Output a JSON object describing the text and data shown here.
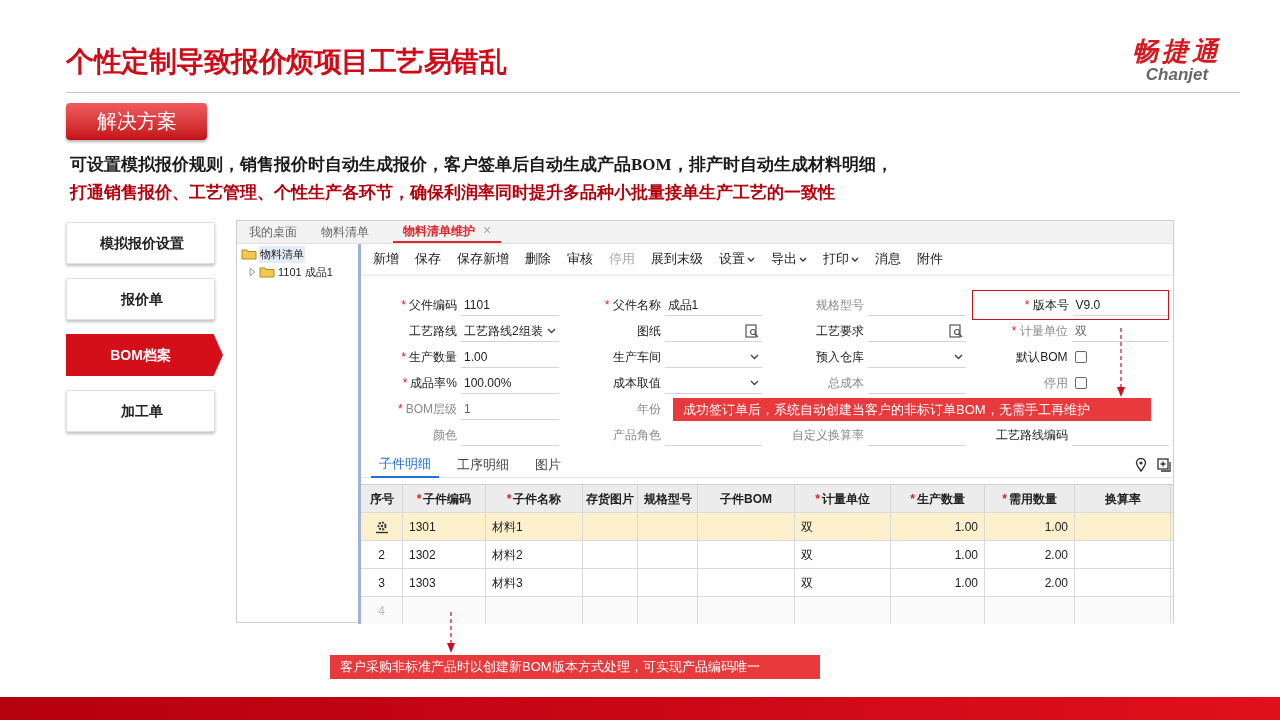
{
  "slide": {
    "title": "个性定制导致报价烦项目工艺易错乱",
    "logo": {
      "mark": "畅捷通",
      "latin": "Chanjet"
    },
    "section_tag": "解决方案",
    "description": [
      {
        "text": "可设置模拟报价规则，销售报价时自动生成报价，客户签单后自动生成产品BOM，排产时自动生成材料明细，",
        "highlight": false
      },
      {
        "text": "打通销售报价、工艺管理、个性生产各环节，确保利润率同时提升多品种小批量接单生产工艺的一致性",
        "highlight": true
      }
    ]
  },
  "nav": [
    {
      "label": "模拟报价设置",
      "selected": false
    },
    {
      "label": "报价单",
      "selected": false
    },
    {
      "label": "BOM档案",
      "selected": true
    },
    {
      "label": "加工单",
      "selected": false
    }
  ],
  "app": {
    "tabs": [
      {
        "label": "我的桌面",
        "selected": false
      },
      {
        "label": "物料清单",
        "selected": false
      },
      {
        "label": "物料清单维护",
        "selected": true,
        "close": "×"
      }
    ],
    "tree": {
      "label": "物料清单",
      "children": [
        {
          "label": "1101 成品1",
          "expanded": false
        }
      ]
    },
    "toolbar": [
      {
        "label": "新增",
        "disabled": false,
        "menu": false
      },
      {
        "label": "保存",
        "disabled": false,
        "menu": false
      },
      {
        "label": "保存新增",
        "disabled": false,
        "menu": false
      },
      {
        "label": "删除",
        "disabled": false,
        "menu": false
      },
      {
        "label": "审核",
        "disabled": false,
        "menu": false
      },
      {
        "label": "停用",
        "disabled": true,
        "menu": false
      },
      {
        "label": "展到末级",
        "disabled": false,
        "menu": false
      },
      {
        "label": "设置",
        "disabled": false,
        "menu": true
      },
      {
        "label": "导出",
        "disabled": false,
        "menu": true
      },
      {
        "label": "打印",
        "disabled": false,
        "menu": true
      },
      {
        "label": "消息",
        "disabled": false,
        "menu": false
      },
      {
        "label": "附件",
        "disabled": false,
        "menu": false
      }
    ],
    "form": [
      [
        {
          "required_mark": "*",
          "label": "父件编码",
          "disabled": false,
          "kind": "text",
          "value": "1101"
        },
        {
          "required_mark": "*",
          "label": "父件名称",
          "disabled": false,
          "kind": "text",
          "value": "成品1"
        },
        {
          "label": "规格型号",
          "disabled": true,
          "kind": "text"
        },
        {
          "required_mark": "*",
          "label": "版本号",
          "disabled": false,
          "kind": "text",
          "value": "V9.0",
          "highlighted": true
        }
      ],
      [
        {
          "label": "工艺路线",
          "disabled": false,
          "kind": "select",
          "value": "工艺路线2组装"
        },
        {
          "label": "图纸",
          "disabled": false,
          "kind": "lookup"
        },
        {
          "label": "工艺要求",
          "disabled": false,
          "kind": "lookup"
        },
        {
          "required_mark": "*",
          "label": "计量单位",
          "disabled": true,
          "kind": "text",
          "value": "双"
        }
      ],
      [
        {
          "required_mark": "*",
          "label": "生产数量",
          "disabled": false,
          "kind": "text",
          "value": "1.00"
        },
        {
          "label": "生产车间",
          "disabled": false,
          "kind": "select"
        },
        {
          "label": "预入仓库",
          "disabled": false,
          "kind": "select"
        },
        {
          "label": "默认BOM",
          "disabled": false,
          "kind": "checkbox",
          "checked": false
        }
      ],
      [
        {
          "required_mark": "*",
          "label": "成品率%",
          "disabled": false,
          "kind": "text",
          "value": "100.00%"
        },
        {
          "label": "成本取值",
          "disabled": false,
          "kind": "select"
        },
        {
          "label": "总成本",
          "disabled": true,
          "kind": "text"
        },
        {
          "label": "停用",
          "disabled": true,
          "kind": "checkbox",
          "checked": false
        }
      ],
      [
        {
          "required_mark": "*",
          "label": "BOM层级",
          "disabled": true,
          "kind": "text",
          "value": "1"
        },
        {
          "label": "年份",
          "disabled": true
        }
      ],
      [
        {
          "label": "颜色",
          "disabled": true,
          "kind": "text"
        },
        {
          "label": "产品角色",
          "disabled": true,
          "kind": "text"
        },
        {
          "label": "自定义换算率",
          "disabled": true,
          "kind": "text"
        },
        {
          "label": "工艺路线编码",
          "disabled": false,
          "kind": "text"
        }
      ]
    ],
    "subtabs": [
      {
        "label": "子件明细",
        "selected": true
      },
      {
        "label": "工序明细",
        "selected": false
      },
      {
        "label": "图片",
        "selected": false
      }
    ],
    "table": {
      "columns": [
        {
          "label": "序号",
          "kind": "center"
        },
        {
          "required_mark": "*",
          "label": "子件编码",
          "kind": "text"
        },
        {
          "required_mark": "*",
          "label": "子件名称",
          "kind": "text"
        },
        {
          "label": "存货图片",
          "kind": "text"
        },
        {
          "label": "规格型号",
          "kind": "text"
        },
        {
          "label": "子件BOM",
          "kind": "text"
        },
        {
          "required_mark": "*",
          "label": "计量单位",
          "kind": "text"
        },
        {
          "required_mark": "*",
          "label": "生产数量",
          "kind": "number"
        },
        {
          "required_mark": "*",
          "label": "需用数量",
          "kind": "number"
        },
        {
          "label": "换算率",
          "kind": "text"
        }
      ],
      "rows": [
        {
          "selected": true,
          "empty": false,
          "cells": [
            null,
            "1301",
            "材料1",
            null,
            null,
            null,
            "双",
            "1.00",
            "1.00",
            null
          ]
        },
        {
          "selected": false,
          "empty": false,
          "cells": [
            "2",
            "1302",
            "材料2",
            null,
            null,
            null,
            "双",
            "1.00",
            "2.00",
            null
          ]
        },
        {
          "selected": false,
          "empty": false,
          "cells": [
            "3",
            "1303",
            "材料3",
            null,
            null,
            null,
            "双",
            "1.00",
            "2.00",
            null
          ]
        },
        {
          "selected": false,
          "empty": true,
          "cells": [
            "4"
          ]
        }
      ]
    }
  },
  "callouts": [
    {
      "text": "成功签订单后，系统自动创建当客户的非标订单BOM，无需手工再维护"
    },
    {
      "text": "客户采购非标准产品时以创建新BOM版本方式处理，可实现产品编码唯一"
    }
  ]
}
